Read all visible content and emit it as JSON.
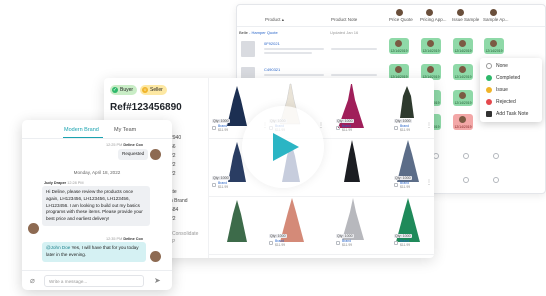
{
  "table": {
    "headers": {
      "product": "Product ▴",
      "note": "Product Note",
      "price_quote": "Price Quote",
      "pricing_app": "Pricing App...",
      "issue_sample": "Issue Sample",
      "sample_app": "Sample Ap..."
    },
    "group_label": "Belle",
    "group_link": "- Hamper Quote",
    "updated": "Updated Jan 16",
    "rows": [
      {
        "code": "0F92021"
      },
      {
        "code": "C490321"
      }
    ],
    "cell_date": "12/14/2019"
  },
  "status_menu": {
    "items": [
      {
        "label": "None",
        "icon": "circle-outline-icon",
        "color": "#ffffff"
      },
      {
        "label": "Completed",
        "icon": "check-circle-icon",
        "color": "#2eb86a"
      },
      {
        "label": "Issue",
        "icon": "warning-icon",
        "color": "#f0b429"
      },
      {
        "label": "Rejected",
        "icon": "x-circle-icon",
        "color": "#e5484d"
      },
      {
        "label": "Add Task Note",
        "icon": "note-icon",
        "color": "#333333"
      }
    ]
  },
  "catalog": {
    "buyer_label": "Buyer",
    "seller_label": "Seller",
    "ref": "Ref#123456890",
    "side_values": [
      "2940",
      "56",
      "22",
      "22",
      "22",
      "",
      "ste",
      "n Brand",
      "584",
      "22"
    ],
    "consolidate_label": "Consolidate",
    "consolidate_sub": "P",
    "qty": "Qty: 1000",
    "brand_link": "Brand",
    "brand_sub": "$11.99"
  },
  "chat": {
    "tabs": [
      "Modern Brand",
      "My Team"
    ],
    "messages": [
      {
        "meta_time": "12:25 PM",
        "meta_name": "Deline Cox",
        "text": "Requested"
      },
      {
        "meta_time": "",
        "meta_name": "",
        "text": ""
      }
    ],
    "day_divider": "Monday, April 18, 2022",
    "incoming_name": "Judy Draper",
    "incoming_time": "12:28 PM",
    "incoming_text": "Hi Deline, please review the products once again, LH123456, LH123456, LH123456, LH123456. I am looking to build out my basics programs with these items. Please provide your best price and earliest delivery!",
    "reply_meta_time": "12:35 PM",
    "reply_meta_name": "Deline Cox",
    "reply_mention": "@John Doe",
    "reply_text": " Yes, I will have that for you today later in the evening.",
    "input_placeholder": "Write a message..."
  },
  "colors": {
    "accent": "#1aa3b0",
    "play": "#2bb5c4",
    "buyer_pill": "#c9edc6",
    "seller_pill": "#fde8a3"
  }
}
